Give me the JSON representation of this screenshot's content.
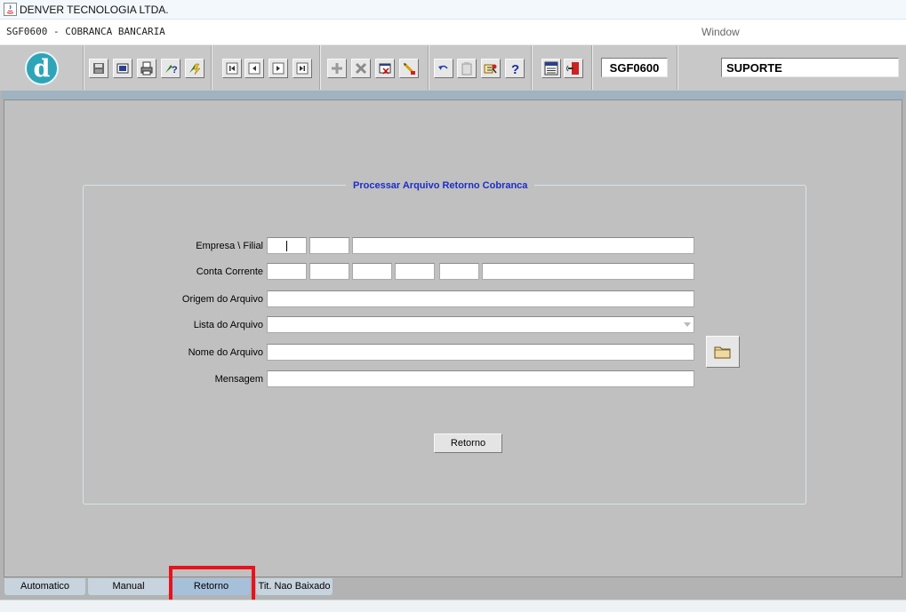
{
  "window": {
    "title": "DENVER TECNOLOGIA LTDA.",
    "form_title": "SGF0600 - COBRANCA BANCARIA",
    "menu_window": "Window"
  },
  "toolbar": {
    "logo_letter": "d",
    "form_code": "SGF0600",
    "user": "SUPORTE",
    "buttons": [
      "save-icon",
      "print-preview-icon",
      "printer-icon",
      "query-icon",
      "execute-query-icon",
      "first-record-icon",
      "previous-record-icon",
      "next-record-icon",
      "last-record-icon",
      "insert-record-icon",
      "delete-record-icon",
      "clear-form-icon",
      "edit-icon",
      "undo-icon",
      "clipboard-icon",
      "key-icon",
      "help-icon",
      "menu-icon",
      "exit-icon"
    ]
  },
  "frame": {
    "title": "Processar Arquivo Retorno Cobranca"
  },
  "form": {
    "empresa_label": "Empresa \\ Filial",
    "conta_label": "Conta Corrente",
    "origem_label": "Origem do Arquivo",
    "lista_label": "Lista do Arquivo",
    "nome_label": "Nome do Arquivo",
    "mensagem_label": "Mensagem",
    "retorno_button": "Retorno"
  },
  "tabs": [
    {
      "label": "Automatico",
      "active": false
    },
    {
      "label": "Manual",
      "active": false
    },
    {
      "label": "Retorno",
      "active": true
    },
    {
      "label": "Tit. Nao Baixado",
      "active": false
    }
  ],
  "colors": {
    "frame_title": "#1b2ec8",
    "highlight": "#e8121c",
    "logo": "#2ea4b8"
  }
}
